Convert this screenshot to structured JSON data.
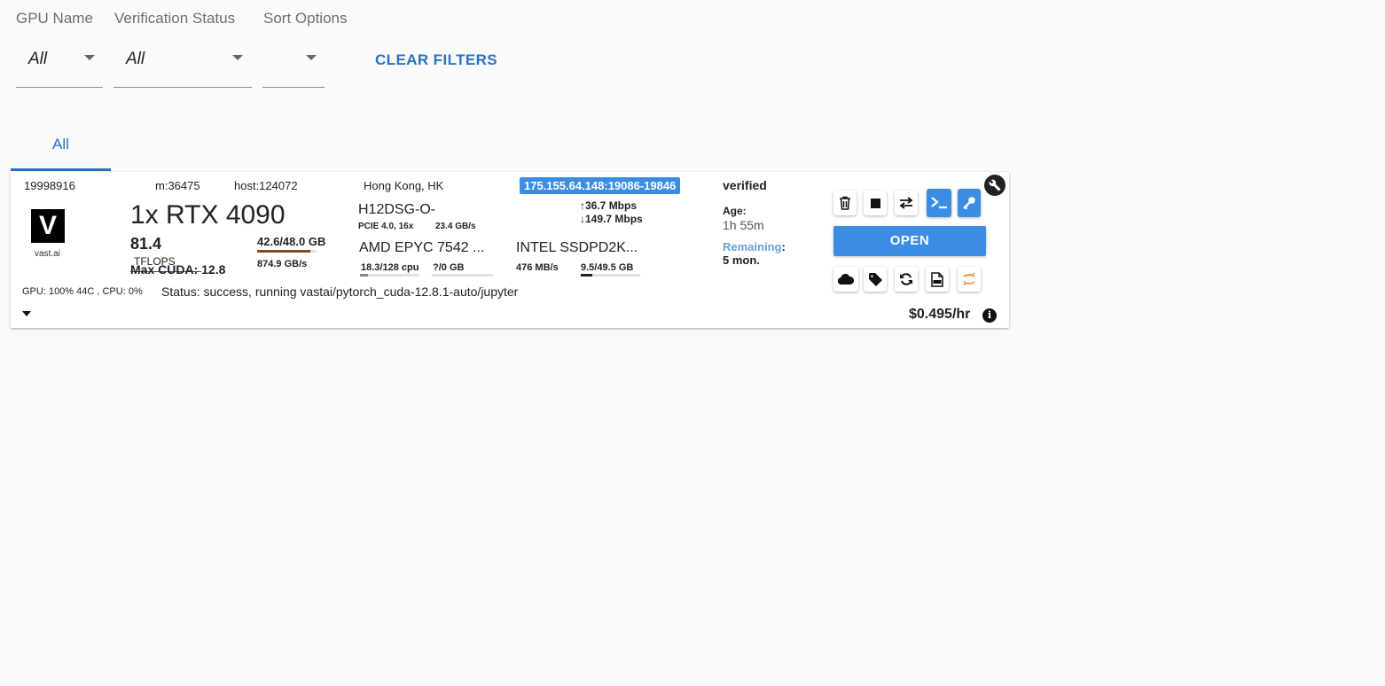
{
  "filters": {
    "gpu_name": {
      "label": "GPU Name",
      "value": "All"
    },
    "verification": {
      "label": "Verification Status",
      "value": "All"
    },
    "sort": {
      "label": "Sort Options",
      "value": ""
    },
    "clear_label": "CLEAR FILTERS"
  },
  "tabs": [
    {
      "label": "All",
      "active": true
    }
  ],
  "instance": {
    "id": "19998916",
    "machine": "m:36475",
    "host": "host:124072",
    "location": "Hong Kong, HK",
    "ip_ports": "175.155.64.148:19086-19846",
    "verification": "verified",
    "logo_letter": "V",
    "logo_text": "vast.ai",
    "gpu": "1x RTX 4090",
    "tflops_value": "81.4",
    "tflops_unit": "TFLOPS",
    "max_cuda": "Max CUDA: 12.8",
    "vram": "42.6/48.0 GB",
    "vram_usage_fraction": 0.89,
    "vram_bandwidth": "874.9 GB/s",
    "motherboard": "H12DSG-O-",
    "pcie": "PCIE 4.0, 16x",
    "pcie_bandwidth": "23.4 GB/s",
    "cpu_name": "AMD EPYC 7542 ...",
    "cpu_usage": "18.3/128 cpu",
    "cpu_usage_fraction": 0.14,
    "ram": "?/0 GB",
    "ram_usage_fraction": 0,
    "upload": "36.7 Mbps",
    "download": "149.7 Mbps",
    "disk_name": "INTEL SSDPD2K...",
    "disk_speed": "476 MB/s",
    "disk_usage": "9.5/49.5 GB",
    "disk_usage_fraction": 0.19,
    "age_label": "Age:",
    "age_value": "1h 55m",
    "remaining_label": "Remaining",
    "remaining_colon": ":",
    "remaining_value": "5 mon.",
    "gpu_cpu_stats": "GPU: 100% 44C , CPU: 0%",
    "status": "Status: success, running vastai/pytorch_cuda-12.8.1-auto/jupyter",
    "price": "$0.495/hr",
    "open_label": "OPEN",
    "buttons_top": [
      "trash-icon",
      "stop-icon",
      "swap-icon",
      "terminal-icon",
      "key-icon"
    ],
    "buttons_bottom": [
      "cloud-icon",
      "tag-icon",
      "refresh-icon",
      "log-icon",
      "jupyter-icon"
    ]
  },
  "colors": {
    "accent": "#2a72c4",
    "button_blue": "#3a8de0",
    "vram_bar": "#7a4a1e",
    "tflops_underline": "#3a3ab8",
    "remaining_label": "#6a9fd8"
  }
}
